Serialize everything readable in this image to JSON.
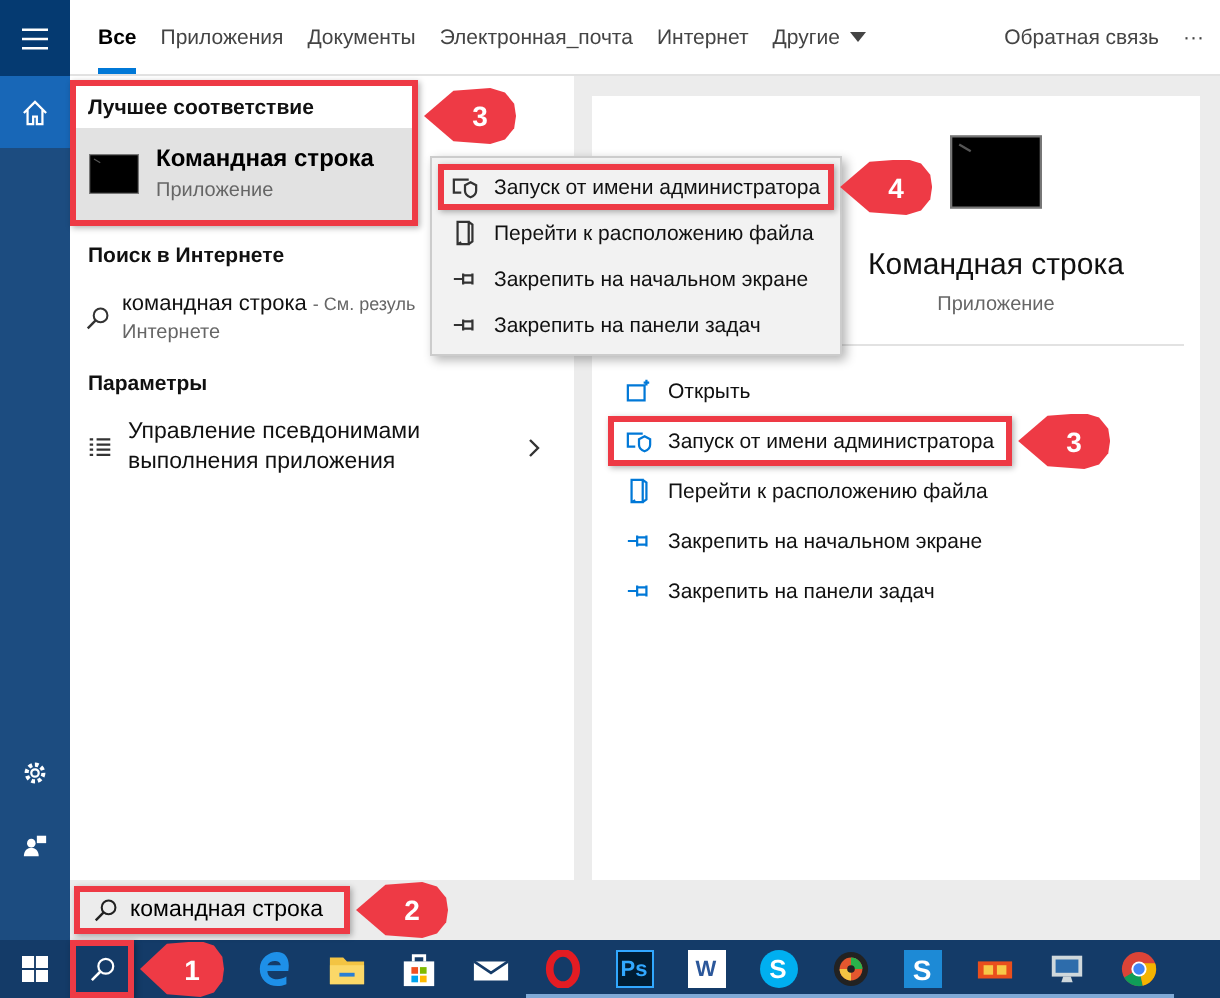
{
  "rail": {
    "top_items": [
      {
        "kind": "home",
        "selected": true
      }
    ],
    "bottom_items": [
      {
        "kind": "settings",
        "selected": false
      },
      {
        "kind": "user",
        "selected": false
      }
    ]
  },
  "tabs": [
    {
      "label": "Все",
      "selected": true
    },
    {
      "label": "Приложения",
      "selected": false
    },
    {
      "label": "Документы",
      "selected": false
    },
    {
      "label": "Электронная_почта",
      "selected": false
    },
    {
      "label": "Интернет",
      "selected": false
    },
    {
      "label": "Другие",
      "selected": false,
      "dropdown": true
    }
  ],
  "feedback": "Обратная связь",
  "more": "···",
  "results": {
    "sections": [
      {
        "title": "Лучшее соответствие",
        "callout": "3",
        "items": [
          {
            "kind": "app",
            "title": "Командная строка",
            "subtitle": "Приложение",
            "selected": true
          }
        ]
      },
      {
        "title": "Поиск в Интернете",
        "items": [
          {
            "kind": "web",
            "title": "командная строка",
            "suffix": "- См. резуль",
            "subtitle": "Интернете",
            "selected": false
          }
        ]
      },
      {
        "title": "Параметры",
        "items": [
          {
            "kind": "setting",
            "title": "Управление псевдонимами выполнения приложения",
            "selected": false
          }
        ]
      }
    ]
  },
  "context_menu": {
    "items": [
      {
        "kind": "run-admin",
        "label": "Запуск от имени администратора",
        "callout": "4"
      },
      {
        "kind": "open-location",
        "label": "Перейти к расположению файла"
      },
      {
        "kind": "pin",
        "label": "Закрепить на начальном экране"
      },
      {
        "kind": "pin",
        "label": "Закрепить на панели задач"
      }
    ]
  },
  "preview": {
    "title": "Командная строка",
    "subtitle": "Приложение",
    "actions": [
      {
        "kind": "open",
        "label": "Открыть"
      },
      {
        "kind": "run-admin",
        "label": "Запуск от имени администратора",
        "callout": "3"
      },
      {
        "kind": "open-location",
        "label": "Перейти к расположению файла"
      },
      {
        "kind": "pin",
        "label": "Закрепить на начальном экране"
      },
      {
        "kind": "pin",
        "label": "Закрепить на панели задач"
      }
    ]
  },
  "search": {
    "value": "командная строка",
    "callout": "2"
  },
  "taskbar": {
    "search_callout": "1",
    "apps": [
      {
        "kind": "edge",
        "running": false
      },
      {
        "kind": "folder",
        "running": false
      },
      {
        "kind": "store",
        "running": false
      },
      {
        "kind": "mail",
        "running": false
      },
      {
        "kind": "opera",
        "running": true
      },
      {
        "kind": "ps",
        "label": "Ps",
        "running": true
      },
      {
        "kind": "word",
        "label": "W",
        "running": true
      },
      {
        "kind": "skype",
        "label": "S",
        "running": true
      },
      {
        "kind": "media",
        "running": true
      },
      {
        "kind": "snag",
        "label": "S",
        "running": true
      },
      {
        "kind": "tool",
        "running": true
      },
      {
        "kind": "monitor",
        "running": true
      },
      {
        "kind": "chrome",
        "running": true
      }
    ]
  }
}
